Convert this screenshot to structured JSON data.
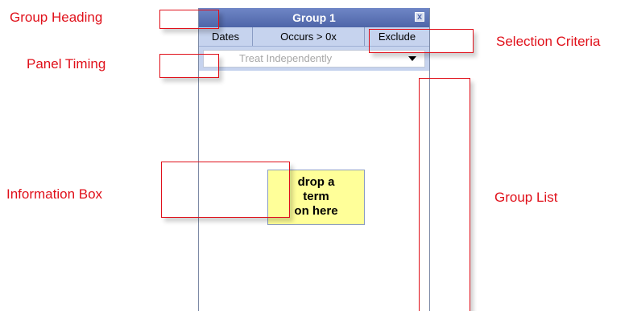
{
  "panel": {
    "title": "Group 1",
    "close_label": "x",
    "criteria": {
      "dates_label": "Dates",
      "occurs_label": "Occurs > 0x",
      "exclude_label": "Exclude"
    },
    "timing": {
      "selected": "Treat Independently"
    },
    "info_box": {
      "line1": "drop a",
      "line2": "term",
      "line3": "on here"
    }
  },
  "callouts": {
    "group_heading": "Group Heading",
    "panel_timing": "Panel Timing",
    "information_box": "Information Box",
    "selection_criteria": "Selection Criteria",
    "group_list": "Group List"
  },
  "colors": {
    "callout": "#e0101a",
    "header": "#4e65a8",
    "criteria_bg": "#c6d3ee",
    "info_bg": "#ffff99"
  }
}
